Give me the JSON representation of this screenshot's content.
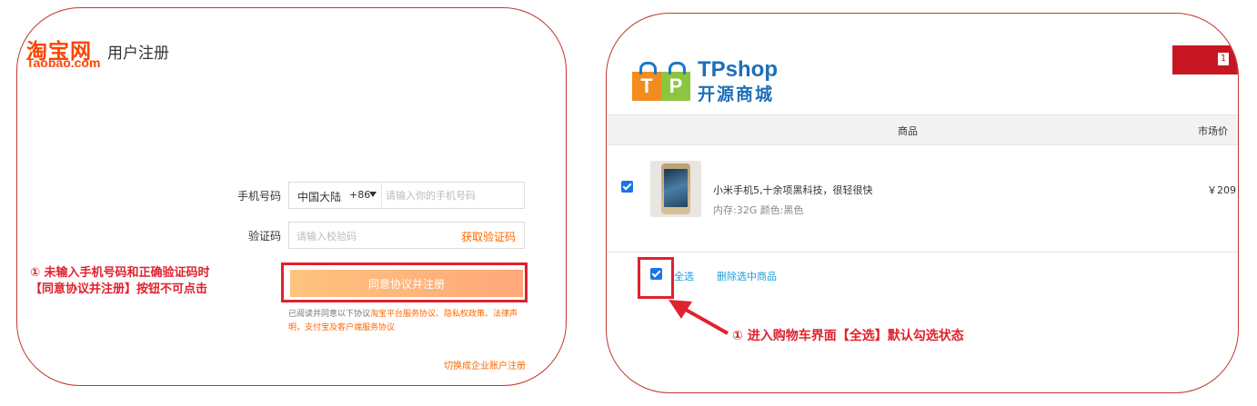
{
  "taobao": {
    "logo_cn": "淘宝网",
    "logo_en": "Taobao.com",
    "title": "用户注册",
    "phone_label": "手机号码",
    "country": "中国大陆",
    "country_code": "+86",
    "phone_placeholder": "请输入你的手机号码",
    "code_label": "验证码",
    "code_placeholder": "请输入校验码",
    "get_code": "获取验证码",
    "agree_button": "同意协议并注册",
    "agree_text_1": "已阅读并同意以下协议",
    "agree_link_1": "淘宝平台服务协议、隐私权政策、法律声明，支付宝及客户端服务协议",
    "switch_link": "切换成企业账户注册",
    "annotation_line1": "① 未输入手机号码和正确验证码时",
    "annotation_line2": "【同意协议并注册】按钮不可点击"
  },
  "tpshop": {
    "logo_letters": [
      "T",
      "P"
    ],
    "logo_name": "TPshop",
    "logo_sub": "开源商城",
    "cart_count": "1",
    "header_product": "商品",
    "header_price": "市场价",
    "product_name": "小米手机5,十余项黑科技，很轻很快",
    "product_attr": "内存:32G 颜色:黑色",
    "price": "￥209",
    "select_all": "全选",
    "delete_selected": "删除选中商品",
    "annotation": "① 进入购物车界面【全选】默认勾选状态"
  },
  "colors": {
    "annotation_red": "#e0212e",
    "taobao_orange": "#ff4400",
    "tpshop_blue": "#1d6fb8",
    "checkbox_blue": "#1a73e8"
  }
}
